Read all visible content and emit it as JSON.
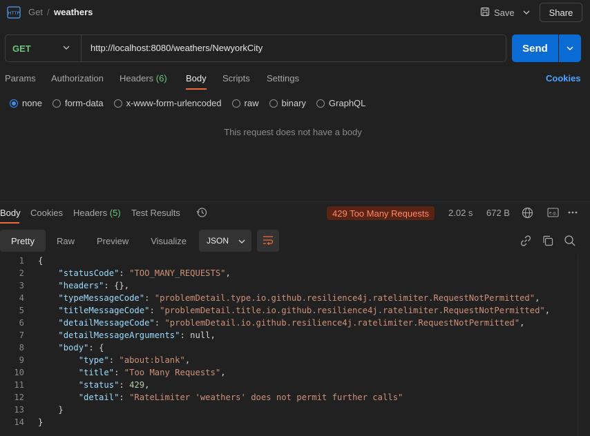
{
  "breadcrumb": {
    "method": "Get",
    "separator": "/",
    "name": "weathers"
  },
  "header": {
    "save_label": "Save",
    "share_label": "Share"
  },
  "request": {
    "method": "GET",
    "url": "http://localhost:8080/weathers/NewyorkCity",
    "send_label": "Send"
  },
  "request_tabs": [
    {
      "label": "Params"
    },
    {
      "label": "Authorization"
    },
    {
      "label": "Headers",
      "count": "(6)"
    },
    {
      "label": "Body"
    },
    {
      "label": "Scripts"
    },
    {
      "label": "Settings"
    }
  ],
  "cookies_label": "Cookies",
  "body_types": [
    "none",
    "form-data",
    "x-www-form-urlencoded",
    "raw",
    "binary",
    "GraphQL"
  ],
  "no_body_message": "This request does not have a body",
  "response_tabs": [
    {
      "label": "Body"
    },
    {
      "label": "Cookies"
    },
    {
      "label": "Headers",
      "count": "(5)"
    },
    {
      "label": "Test Results"
    }
  ],
  "response": {
    "status": "429 Too Many Requests",
    "time": "2.02 s",
    "size": "672 B"
  },
  "view_modes": [
    "Pretty",
    "Raw",
    "Preview",
    "Visualize"
  ],
  "format": "JSON",
  "code_lines": [
    [
      {
        "t": "p",
        "v": "{"
      }
    ],
    [
      {
        "t": "p",
        "v": "    "
      },
      {
        "t": "k",
        "v": "\"statusCode\""
      },
      {
        "t": "p",
        "v": ": "
      },
      {
        "t": "s",
        "v": "\"TOO_MANY_REQUESTS\""
      },
      {
        "t": "p",
        "v": ","
      }
    ],
    [
      {
        "t": "p",
        "v": "    "
      },
      {
        "t": "k",
        "v": "\"headers\""
      },
      {
        "t": "p",
        "v": ": {},"
      }
    ],
    [
      {
        "t": "p",
        "v": "    "
      },
      {
        "t": "k",
        "v": "\"typeMessageCode\""
      },
      {
        "t": "p",
        "v": ": "
      },
      {
        "t": "s",
        "v": "\"problemDetail.type.io.github.resilience4j.ratelimiter.RequestNotPermitted\""
      },
      {
        "t": "p",
        "v": ","
      }
    ],
    [
      {
        "t": "p",
        "v": "    "
      },
      {
        "t": "k",
        "v": "\"titleMessageCode\""
      },
      {
        "t": "p",
        "v": ": "
      },
      {
        "t": "s",
        "v": "\"problemDetail.title.io.github.resilience4j.ratelimiter.RequestNotPermitted\""
      },
      {
        "t": "p",
        "v": ","
      }
    ],
    [
      {
        "t": "p",
        "v": "    "
      },
      {
        "t": "k",
        "v": "\"detailMessageCode\""
      },
      {
        "t": "p",
        "v": ": "
      },
      {
        "t": "s",
        "v": "\"problemDetail.io.github.resilience4j.ratelimiter.RequestNotPermitted\""
      },
      {
        "t": "p",
        "v": ","
      }
    ],
    [
      {
        "t": "p",
        "v": "    "
      },
      {
        "t": "k",
        "v": "\"detailMessageArguments\""
      },
      {
        "t": "p",
        "v": ": null,"
      }
    ],
    [
      {
        "t": "p",
        "v": "    "
      },
      {
        "t": "k",
        "v": "\"body\""
      },
      {
        "t": "p",
        "v": ": {"
      }
    ],
    [
      {
        "t": "p",
        "v": "        "
      },
      {
        "t": "k",
        "v": "\"type\""
      },
      {
        "t": "p",
        "v": ": "
      },
      {
        "t": "s",
        "v": "\"about:blank\""
      },
      {
        "t": "p",
        "v": ","
      }
    ],
    [
      {
        "t": "p",
        "v": "        "
      },
      {
        "t": "k",
        "v": "\"title\""
      },
      {
        "t": "p",
        "v": ": "
      },
      {
        "t": "s",
        "v": "\"Too Many Requests\""
      },
      {
        "t": "p",
        "v": ","
      }
    ],
    [
      {
        "t": "p",
        "v": "        "
      },
      {
        "t": "k",
        "v": "\"status\""
      },
      {
        "t": "p",
        "v": ": "
      },
      {
        "t": "n",
        "v": "429"
      },
      {
        "t": "p",
        "v": ","
      }
    ],
    [
      {
        "t": "p",
        "v": "        "
      },
      {
        "t": "k",
        "v": "\"detail\""
      },
      {
        "t": "p",
        "v": ": "
      },
      {
        "t": "s",
        "v": "\"RateLimiter 'weathers' does not permit further calls\""
      }
    ],
    [
      {
        "t": "p",
        "v": "    }"
      }
    ],
    [
      {
        "t": "p",
        "v": "}"
      }
    ]
  ],
  "colors": {
    "accent_orange": "#f26b3a",
    "send_blue": "#0b6bd4",
    "method_green": "#6bc77b",
    "status_error_bg": "#5a2414",
    "status_error_text": "#ff8a65"
  }
}
